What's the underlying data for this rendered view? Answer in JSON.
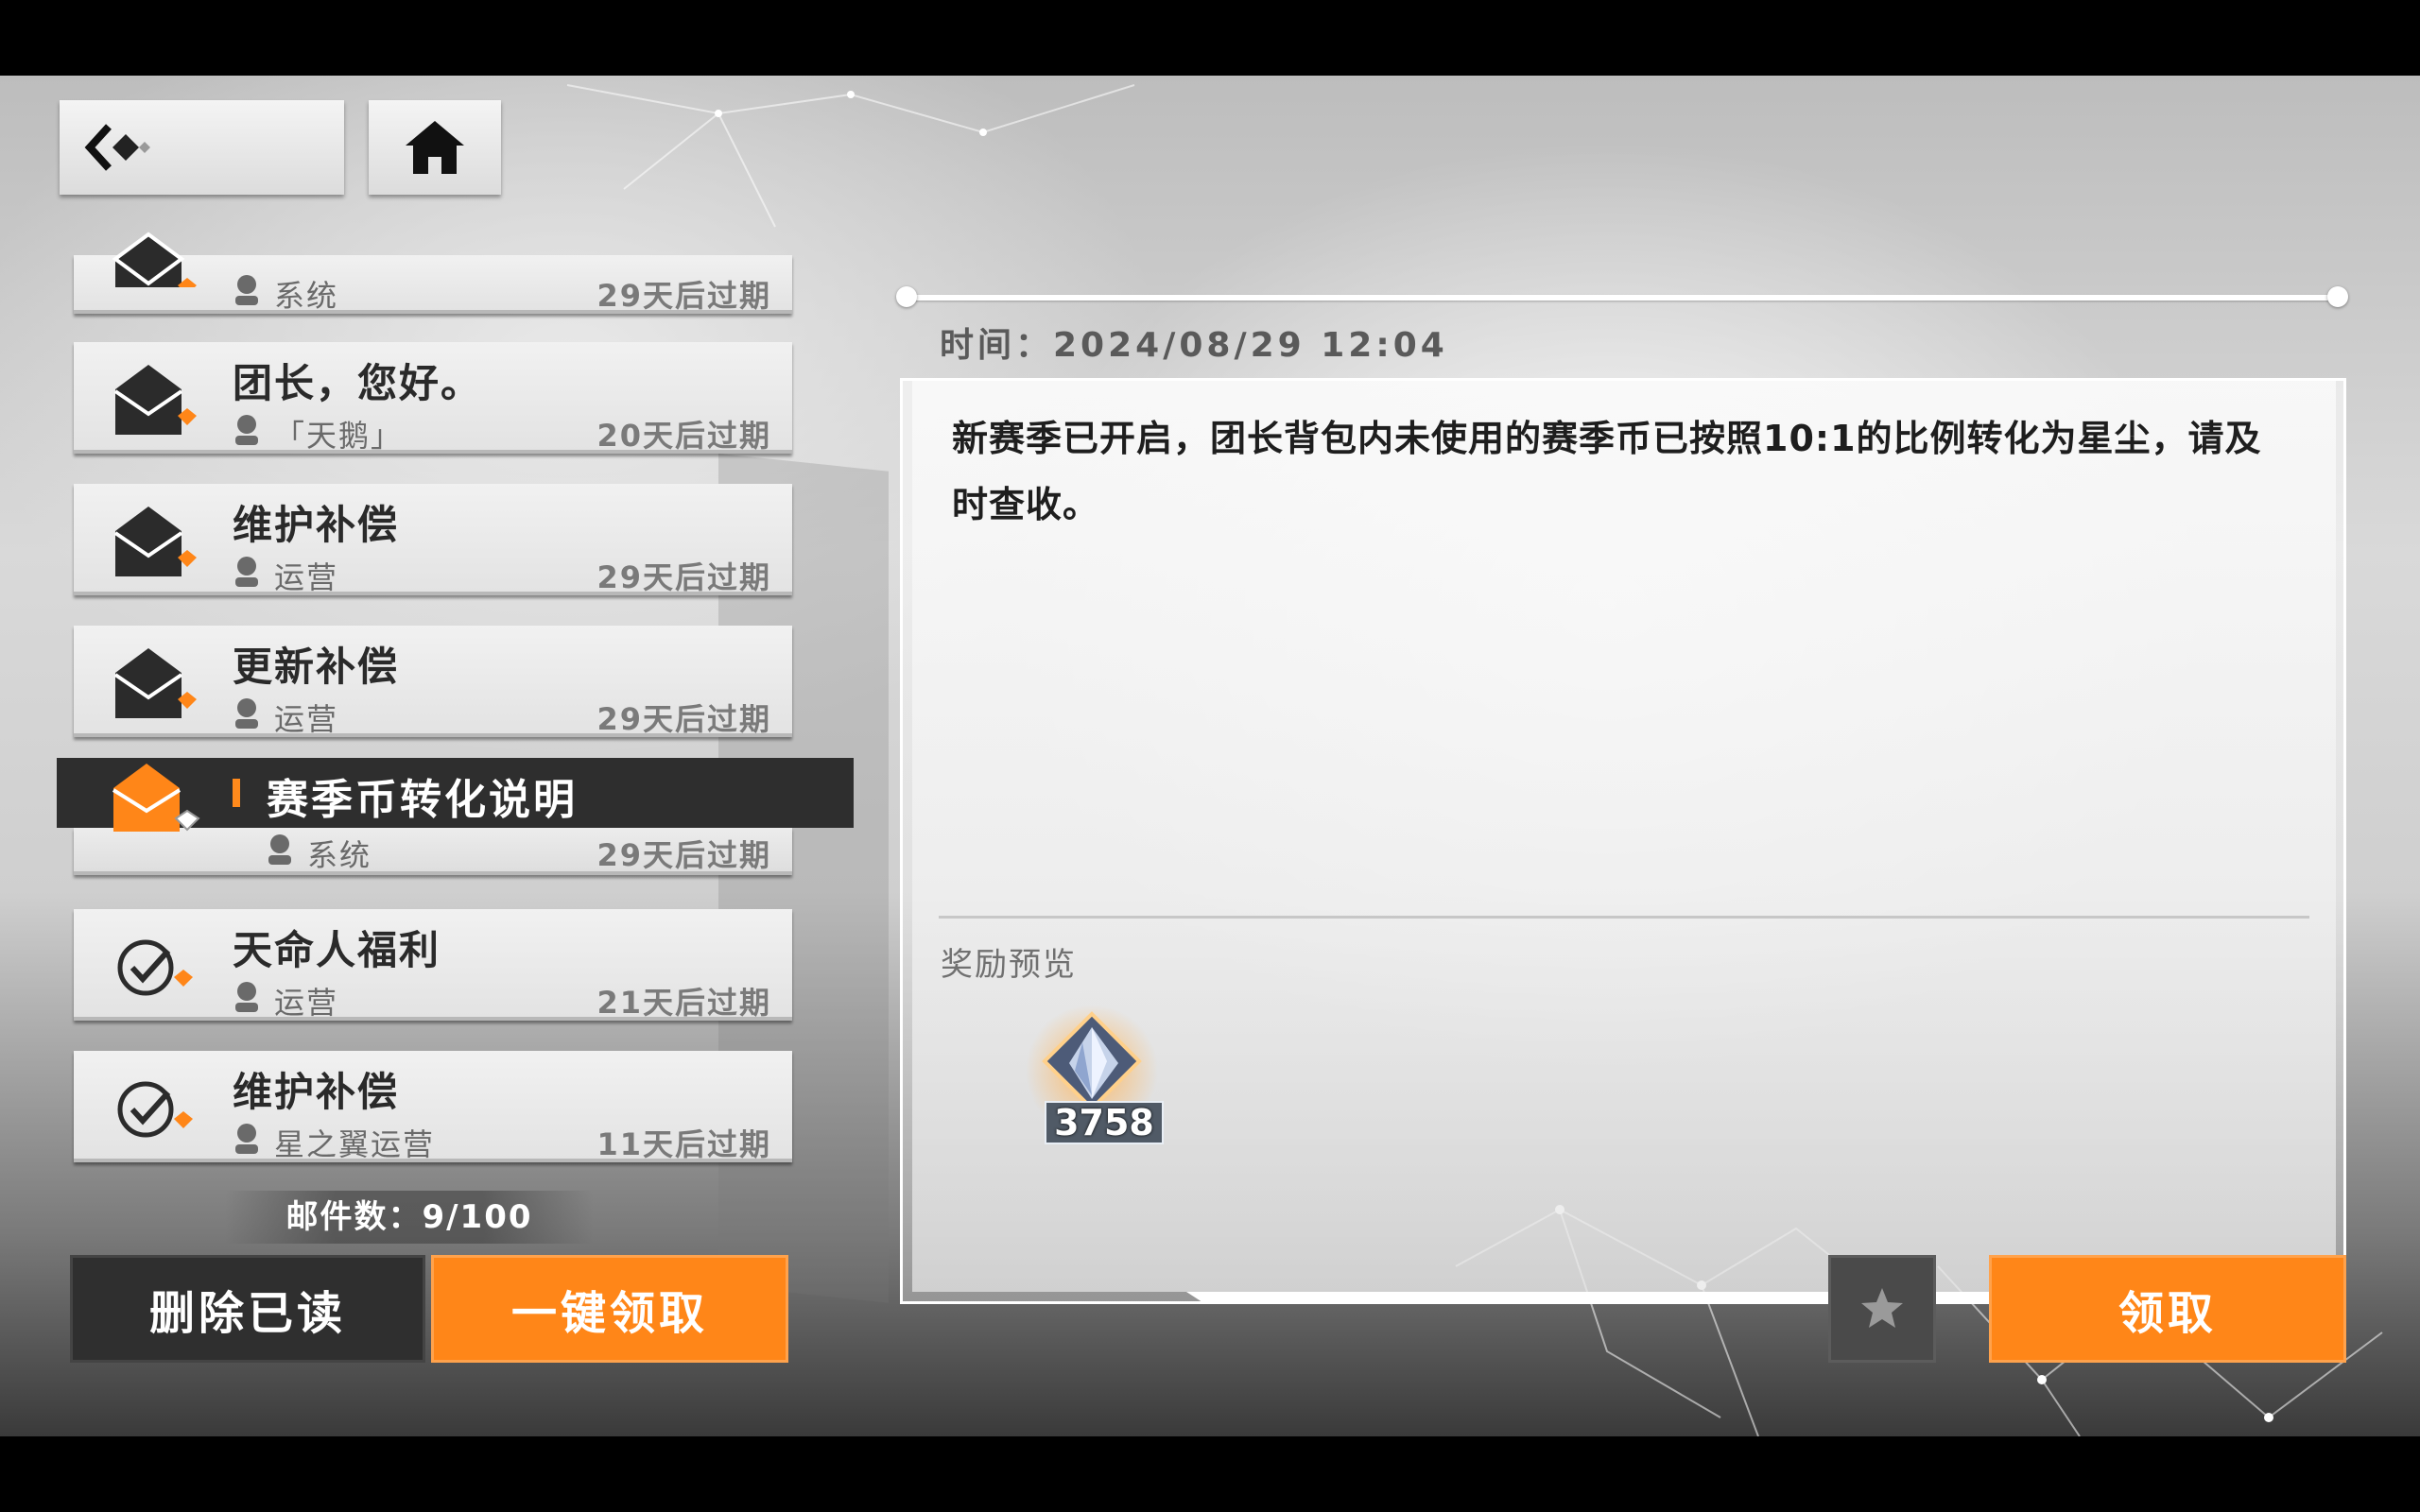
{
  "nav": {
    "back_icon": "back-arrow-icon",
    "home_icon": "home-icon"
  },
  "mails": [
    {
      "title": "",
      "sender": "系统",
      "expire": "29天后过期",
      "status": "read",
      "partial": true
    },
    {
      "title": "团长，您好。",
      "sender": "「天鹅」",
      "expire": "20天后过期",
      "status": "read"
    },
    {
      "title": "维护补偿",
      "sender": "运营",
      "expire": "29天后过期",
      "status": "read"
    },
    {
      "title": "更新补偿",
      "sender": "运营",
      "expire": "29天后过期",
      "status": "read"
    },
    {
      "title": "赛季币转化说明",
      "sender": "系统",
      "expire": "29天后过期",
      "status": "selected"
    },
    {
      "title": "天命人福利",
      "sender": "运营",
      "expire": "21天后过期",
      "status": "claimed"
    },
    {
      "title": "维护补偿",
      "sender": "星之翼运营",
      "expire": "11天后过期",
      "status": "claimed"
    }
  ],
  "mail_count": "邮件数：9/100",
  "buttons": {
    "delete_read": "删除已读",
    "claim_all": "一键领取",
    "star_icon": "star-icon",
    "claim": "领取"
  },
  "detail": {
    "time": "时间：2024/08/29 12:04",
    "body_line1": "新赛季已开启，团长背包内未使用的赛季币已按照10:1的比例转化为星尘，请及",
    "body_line2": "时查收。",
    "reward_label": "奖励预览",
    "reward_item": {
      "icon": "stardust-crystal-icon",
      "count": "3758"
    }
  },
  "colors": {
    "accent": "#ff8618",
    "selected_bg": "#2e2e2e"
  }
}
